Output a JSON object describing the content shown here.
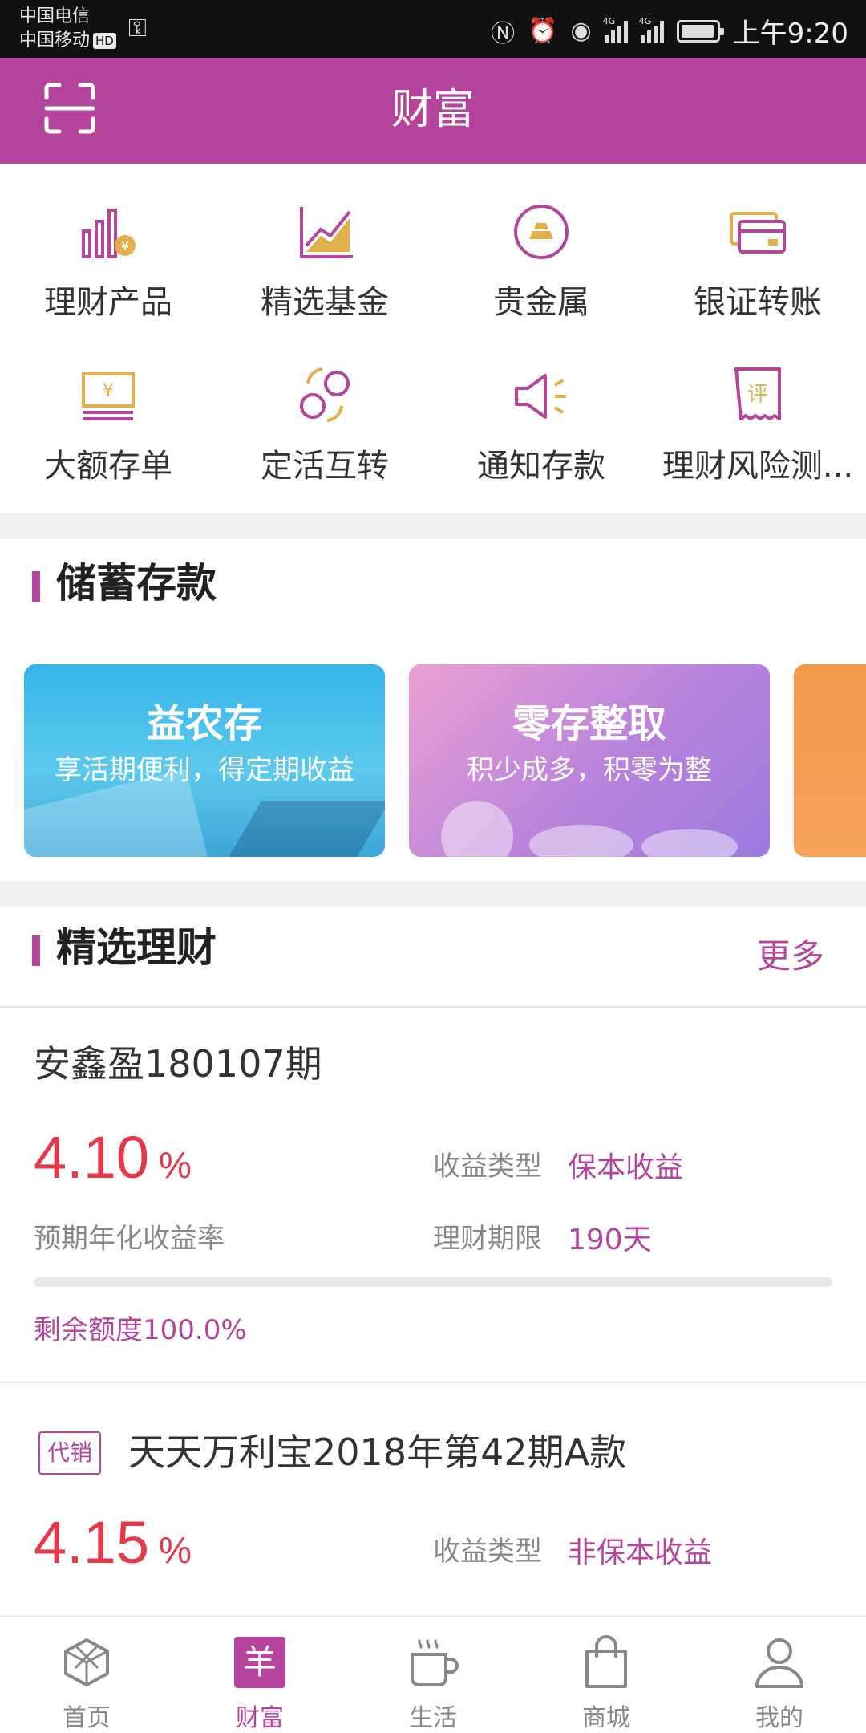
{
  "status_bar": {
    "carrier_1": "中国电信",
    "carrier_2": "中国移动",
    "hd_badge": "HD",
    "time": "上午9:20",
    "network_1": "4G",
    "network_2": "4G"
  },
  "header": {
    "title": "财富"
  },
  "quick_menu": [
    {
      "label": "理财产品",
      "icon": "financial-products-icon"
    },
    {
      "label": "精选基金",
      "icon": "selected-funds-icon"
    },
    {
      "label": "贵金属",
      "icon": "precious-metals-icon"
    },
    {
      "label": "银证转账",
      "icon": "bank-securities-transfer-icon"
    },
    {
      "label": "大额存单",
      "icon": "large-deposit-icon"
    },
    {
      "label": "定活互转",
      "icon": "fixed-current-exchange-icon"
    },
    {
      "label": "通知存款",
      "icon": "notice-deposit-icon"
    },
    {
      "label": "理财风险测...",
      "icon": "risk-assessment-icon"
    }
  ],
  "savings": {
    "title": "储蓄存款",
    "cards": [
      {
        "title": "益农存",
        "subtitle": "享活期便利，得定期收益"
      },
      {
        "title": "零存整取",
        "subtitle": "积少成多，积零为整"
      }
    ]
  },
  "featured": {
    "title": "精选理财",
    "more": "更多",
    "products": [
      {
        "name": "安鑫盈180107期",
        "rate": "4.10",
        "unit": "%",
        "rate_label": "预期年化收益率",
        "type_label": "收益类型",
        "type_value": "保本收益",
        "term_label": "理财期限",
        "term_value": "190天",
        "remaining": "剩余额度100.0%",
        "sold_fraction": 0.0
      },
      {
        "tag": "代销",
        "name": "天天万利宝2018年第42期A款",
        "rate": "4.15",
        "unit": "%",
        "type_label": "收益类型",
        "type_value": "非保本收益"
      }
    ]
  },
  "bottom_nav": [
    {
      "label": "首页",
      "icon": "home-icon"
    },
    {
      "label": "财富",
      "icon": "wealth-icon",
      "active": true
    },
    {
      "label": "生活",
      "icon": "life-icon"
    },
    {
      "label": "商城",
      "icon": "shop-icon"
    },
    {
      "label": "我的",
      "icon": "profile-icon"
    }
  ],
  "colors": {
    "brand": "#b5459c",
    "rate_red": "#e5384b",
    "icon_gold": "#e1b04d"
  }
}
